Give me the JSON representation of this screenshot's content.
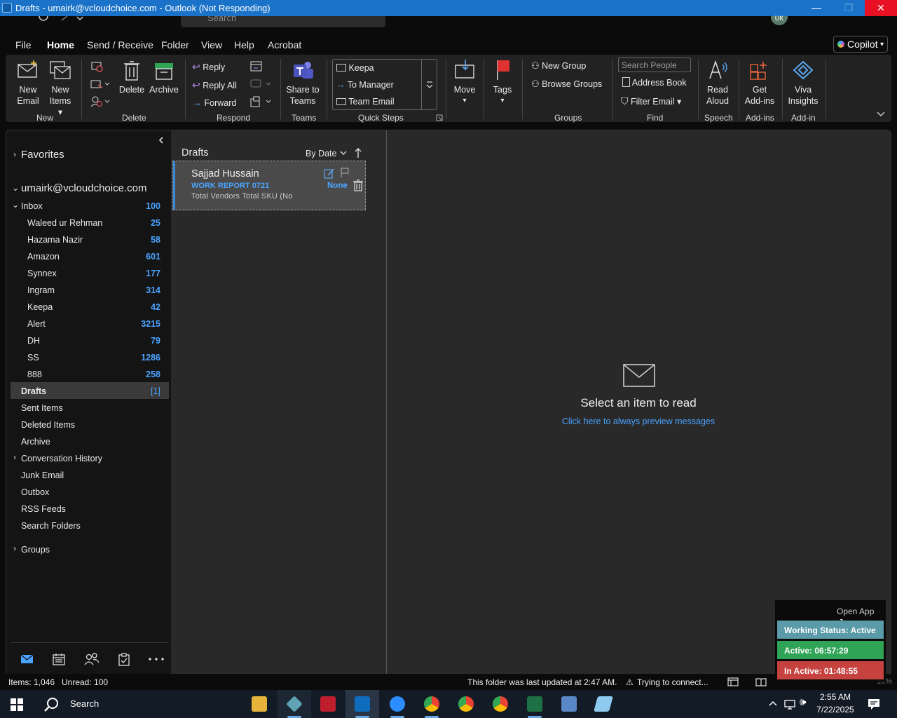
{
  "window": {
    "title": "Drafts - umairk@vcloudchoice.com - Outlook (Not Responding)",
    "minimize_glyph": "—",
    "maximize_glyph": "❐",
    "close_glyph": "✕"
  },
  "topstrip": {
    "search_placeholder": "Search",
    "avatar_initials": "UK"
  },
  "menu": {
    "file": "File",
    "home": "Home",
    "send_receive": "Send / Receive",
    "folder": "Folder",
    "view": "View",
    "help": "Help",
    "acrobat": "Acrobat",
    "copilot": "Copilot"
  },
  "ribbon": {
    "new_email": [
      "New",
      "Email"
    ],
    "new_items": [
      "New",
      "Items ▾"
    ],
    "group_new": "New",
    "delete": "Delete",
    "archive": "Archive",
    "group_delete": "Delete",
    "reply": "Reply",
    "reply_all": "Reply All",
    "forward": "Forward",
    "group_respond": "Respond",
    "share_to_teams": [
      "Share to",
      "Teams"
    ],
    "group_teams": "Teams",
    "quick_steps": [
      "Keepa",
      "To Manager",
      "Team Email"
    ],
    "group_quick_steps": "Quick Steps",
    "move": "Move",
    "tags": "Tags",
    "new_group": "New Group",
    "browse_groups": "Browse Groups",
    "group_groups": "Groups",
    "search_people_placeholder": "Search People",
    "address_book": "Address Book",
    "filter_email": "Filter Email ▾",
    "group_find": "Find",
    "read_aloud": [
      "Read",
      "Aloud"
    ],
    "group_speech": "Speech",
    "get_addins": [
      "Get",
      "Add-ins"
    ],
    "group_addins": "Add-ins",
    "viva_insights": [
      "Viva",
      "Insights"
    ],
    "group_addin": "Add-in"
  },
  "folders": {
    "favorites": "Favorites",
    "account": "umairk@vcloudchoice.com",
    "inbox": {
      "name": "Inbox",
      "count": "100"
    },
    "subfolders": [
      {
        "name": "Waleed ur Rehman",
        "count": "25"
      },
      {
        "name": "Hazama Nazir",
        "count": "58"
      },
      {
        "name": "Amazon",
        "count": "601"
      },
      {
        "name": "Synnex",
        "count": "177"
      },
      {
        "name": "Ingram",
        "count": "314"
      },
      {
        "name": "Keepa",
        "count": "42"
      },
      {
        "name": "Alert",
        "count": "3215"
      },
      {
        "name": "DH",
        "count": "79"
      },
      {
        "name": "SS",
        "count": "1286"
      },
      {
        "name": "888",
        "count": "258"
      }
    ],
    "drafts": {
      "name": "Drafts",
      "count": "[1]"
    },
    "others": [
      "Sent Items",
      "Deleted Items",
      "Archive",
      "Conversation History",
      "Junk Email",
      "Outbox",
      "RSS Feeds",
      "Search Folders"
    ],
    "groups": "Groups"
  },
  "message_list": {
    "header": "Drafts",
    "sort": "By Date",
    "messages": [
      {
        "sender": "Sajjad Hussain",
        "subject": "WORK REPORT 0721",
        "category": "None",
        "preview": "Total Vendors  Total SKU (No"
      }
    ]
  },
  "reading_pane": {
    "title": "Select an item to read",
    "link": "Click here to always preview messages"
  },
  "status": {
    "items": "Items: 1,046",
    "unread": "Unread: 100",
    "updated": "This folder was last updated at 2:47 AM.",
    "connection": "Trying to connect...",
    "zoom": "10%"
  },
  "widget": {
    "open_app": "Open App ↗",
    "working_status": "Working Status: Active",
    "active": "Active: 06:57:29",
    "inactive": "In Active: 01:48:55",
    "colors": {
      "status": "#5b9aa8",
      "active": "#2fa356",
      "inactive": "#c5423f"
    }
  },
  "taskbar": {
    "search": "Search",
    "time": "2:55 AM",
    "date": "7/22/2025",
    "apps": [
      "file-explorer-icon",
      "app-icon",
      "filezilla-icon",
      "outlook-icon",
      "zoom-icon",
      "chrome-icon",
      "chrome-icon",
      "chrome-icon",
      "excel-icon",
      "calculator-icon",
      "notes-icon"
    ]
  }
}
